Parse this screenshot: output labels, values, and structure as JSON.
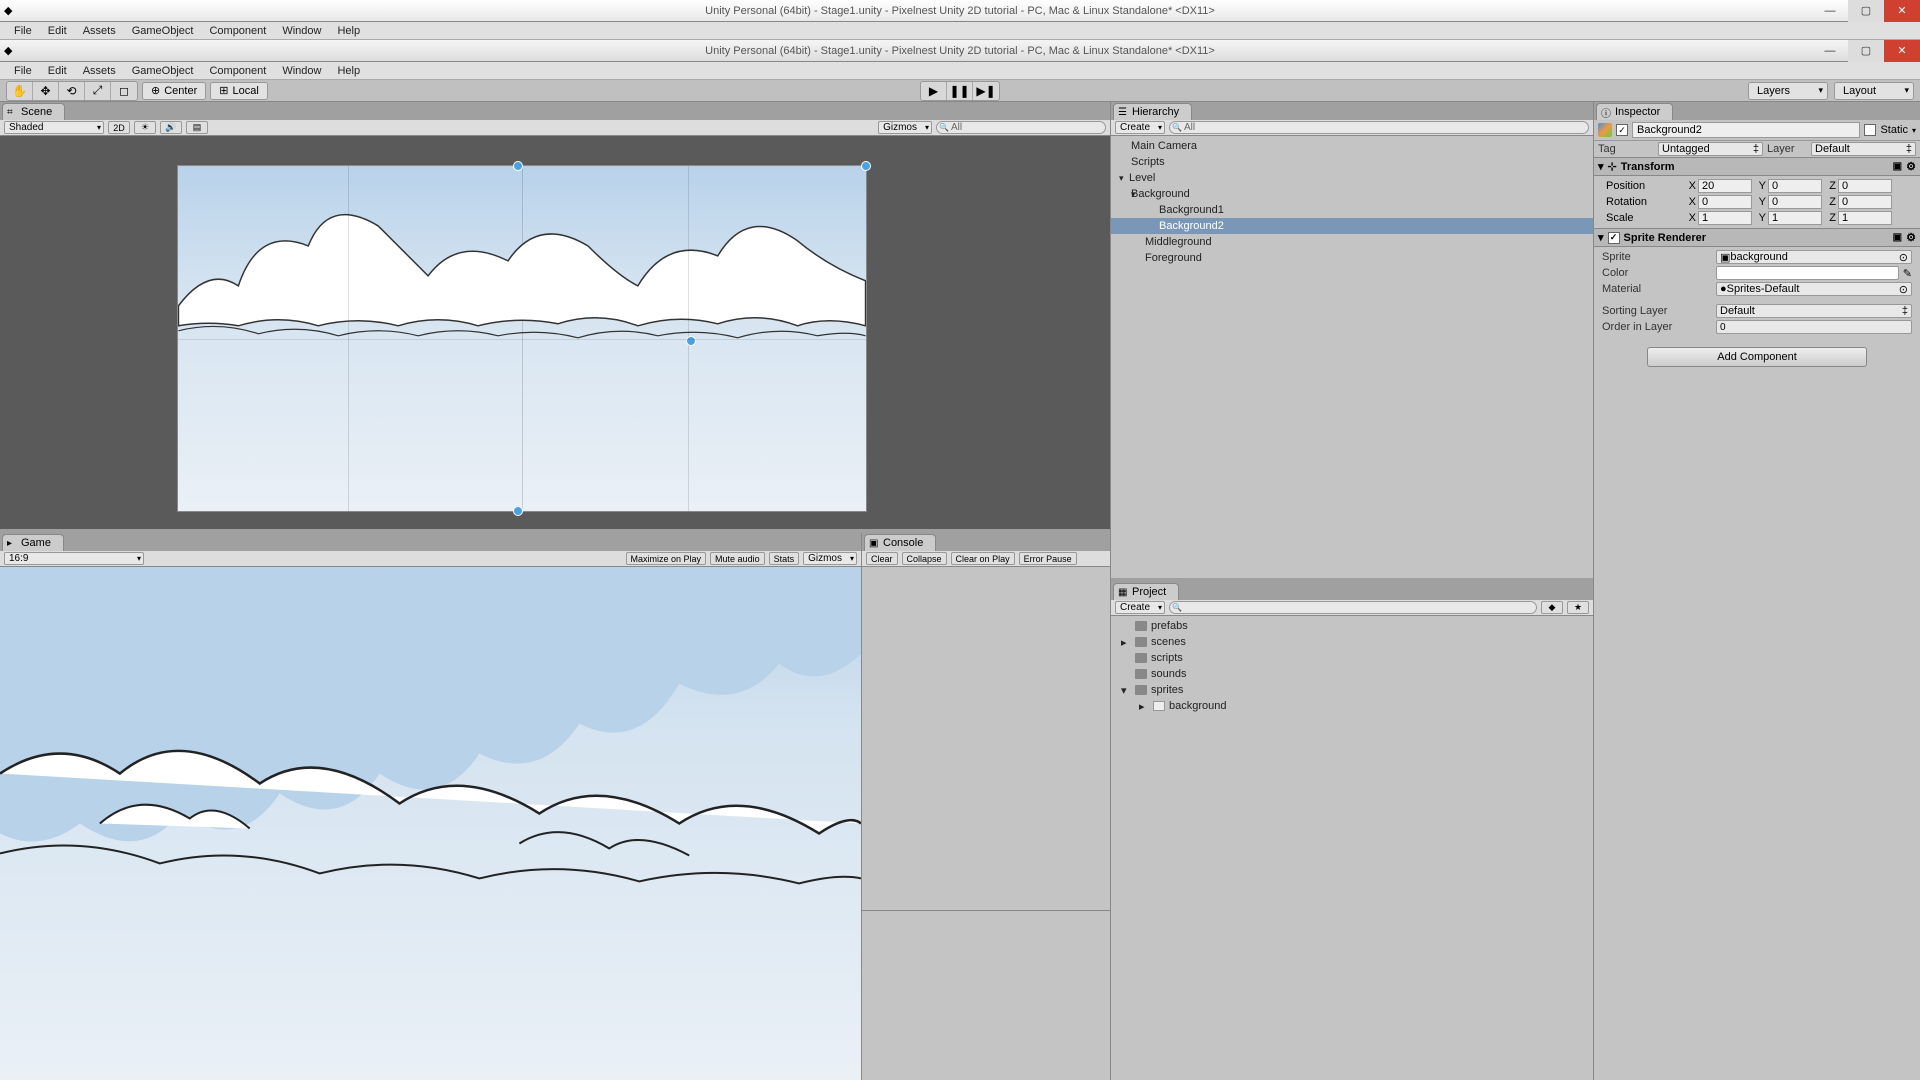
{
  "titlebar": {
    "title": "Unity Personal (64bit) - Stage1.unity - Pixelnest Unity 2D tutorial - PC, Mac & Linux Standalone* <DX11>"
  },
  "menubar": [
    "File",
    "Edit",
    "Assets",
    "GameObject",
    "Component",
    "Window",
    "Help"
  ],
  "toolbar": {
    "center_label": "Center",
    "local_label": "Local",
    "layers": "Layers",
    "layout": "Layout"
  },
  "scene_panel": {
    "tab": "Scene",
    "shading": "Shaded",
    "mode_2d": "2D",
    "gizmos": "Gizmos",
    "search_placeholder": "All"
  },
  "game_panel": {
    "tab": "Game",
    "aspect": "16:9",
    "buttons": [
      "Maximize on Play",
      "Mute audio",
      "Stats",
      "Gizmos"
    ]
  },
  "console_panel": {
    "tab": "Console",
    "buttons": [
      "Clear",
      "Collapse",
      "Clear on Play",
      "Error Pause"
    ]
  },
  "hierarchy_panel": {
    "tab": "Hierarchy",
    "create": "Create",
    "search_placeholder": "All",
    "items": [
      {
        "name": "Main Camera",
        "depth": 0
      },
      {
        "name": "Scripts",
        "depth": 0
      },
      {
        "name": "Level",
        "depth": 0,
        "expanded": true
      },
      {
        "name": "Background",
        "depth": 1,
        "expanded": true
      },
      {
        "name": "Background1",
        "depth": 2
      },
      {
        "name": "Background2",
        "depth": 2,
        "selected": true
      },
      {
        "name": "Middleground",
        "depth": 1
      },
      {
        "name": "Foreground",
        "depth": 1
      }
    ]
  },
  "project_panel": {
    "tab": "Project",
    "create": "Create",
    "items": [
      {
        "name": "prefabs",
        "depth": 0
      },
      {
        "name": "scenes",
        "depth": 0,
        "hasArrow": true
      },
      {
        "name": "scripts",
        "depth": 0
      },
      {
        "name": "sounds",
        "depth": 0
      },
      {
        "name": "sprites",
        "depth": 0,
        "expanded": true
      },
      {
        "name": "background",
        "depth": 1,
        "isFile": true
      }
    ]
  },
  "inspector": {
    "tab": "Inspector",
    "object_name": "Background2",
    "static_label": "Static",
    "tag_label": "Tag",
    "tag_value": "Untagged",
    "layer_label": "Layer",
    "layer_value": "Default",
    "transform": {
      "title": "Transform",
      "position_label": "Position",
      "rotation_label": "Rotation",
      "scale_label": "Scale",
      "position": {
        "x": "20",
        "y": "0",
        "z": "0"
      },
      "rotation": {
        "x": "0",
        "y": "0",
        "z": "0"
      },
      "scale": {
        "x": "1",
        "y": "1",
        "z": "1"
      }
    },
    "sprite_renderer": {
      "title": "Sprite Renderer",
      "sprite_label": "Sprite",
      "sprite_value": "background",
      "color_label": "Color",
      "material_label": "Material",
      "material_value": "Sprites-Default",
      "sorting_layer_label": "Sorting Layer",
      "sorting_layer_value": "Default",
      "order_label": "Order in Layer",
      "order_value": "0"
    },
    "add_component": "Add Component"
  }
}
